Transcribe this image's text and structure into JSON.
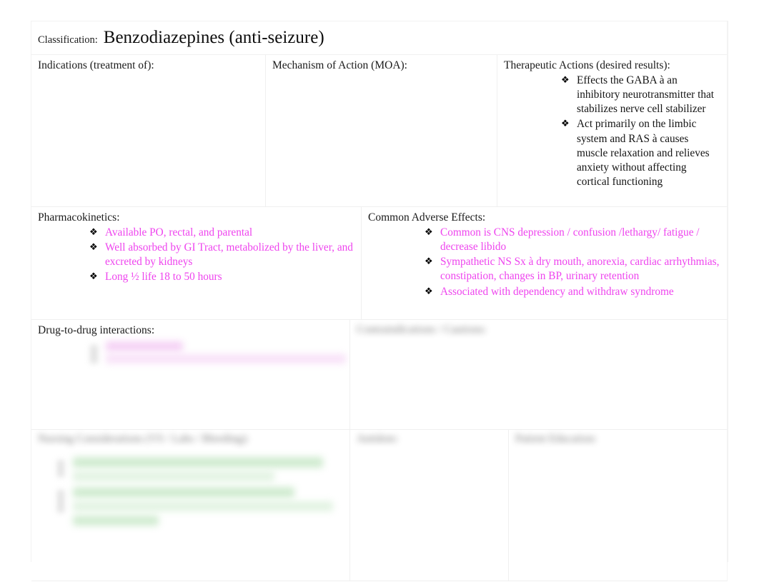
{
  "document": {
    "type": "drug-card-worksheet",
    "classification_label": "Classification:",
    "classification_value": "Benzodiazepines (anti-seizure)"
  },
  "colors": {
    "accent_pink": "#ee44ee",
    "accent_green": "#c8e8c8",
    "text": "#141414",
    "grid": "#f0f0f0"
  },
  "bullet_glyph": "❖",
  "sections": {
    "indications": {
      "heading": "Indications (treatment of):",
      "items": []
    },
    "moa": {
      "heading": "Mechanism of Action (MOA):",
      "items": []
    },
    "therapeutic_actions": {
      "heading": "Therapeutic Actions (desired results):",
      "items": [
        "Effects the GABA à an inhibitory neurotransmitter that stabilizes nerve cell stabilizer",
        "Act primarily on the limbic system and RAS à causes muscle relaxation and relieves anxiety without affecting cortical functioning"
      ]
    },
    "pharmacokinetics": {
      "heading": "Pharmacokinetics:",
      "items": [
        "Available PO, rectal, and parental",
        "Well absorbed by GI Tract, metabolized by the liver, and excreted by kidneys",
        "Long ½ life 18 to 50 hours"
      ]
    },
    "adverse_effects": {
      "heading": "Common Adverse Effects:",
      "items": [
        "Common is CNS depression / confusion /lethargy/ fatigue / decrease libido",
        "Sympathetic NS Sx à dry mouth, anorexia, cardiac arrhythmias, constipation, changes in BP, urinary retention",
        "Associated with dependency and withdraw syndrome"
      ]
    },
    "interactions": {
      "heading": "Drug-to-drug interactions:",
      "items_redacted": true,
      "redacted_note": ""
    },
    "contraindications": {
      "heading_redacted": true,
      "heading": "",
      "items_redacted": true
    },
    "nursing_considerations": {
      "heading_redacted": true,
      "heading": "",
      "items_redacted": true
    },
    "antidote": {
      "heading_redacted": true,
      "heading": "",
      "items_redacted": true
    },
    "patient_education": {
      "heading_redacted": true,
      "heading": "",
      "items_redacted": true
    }
  }
}
